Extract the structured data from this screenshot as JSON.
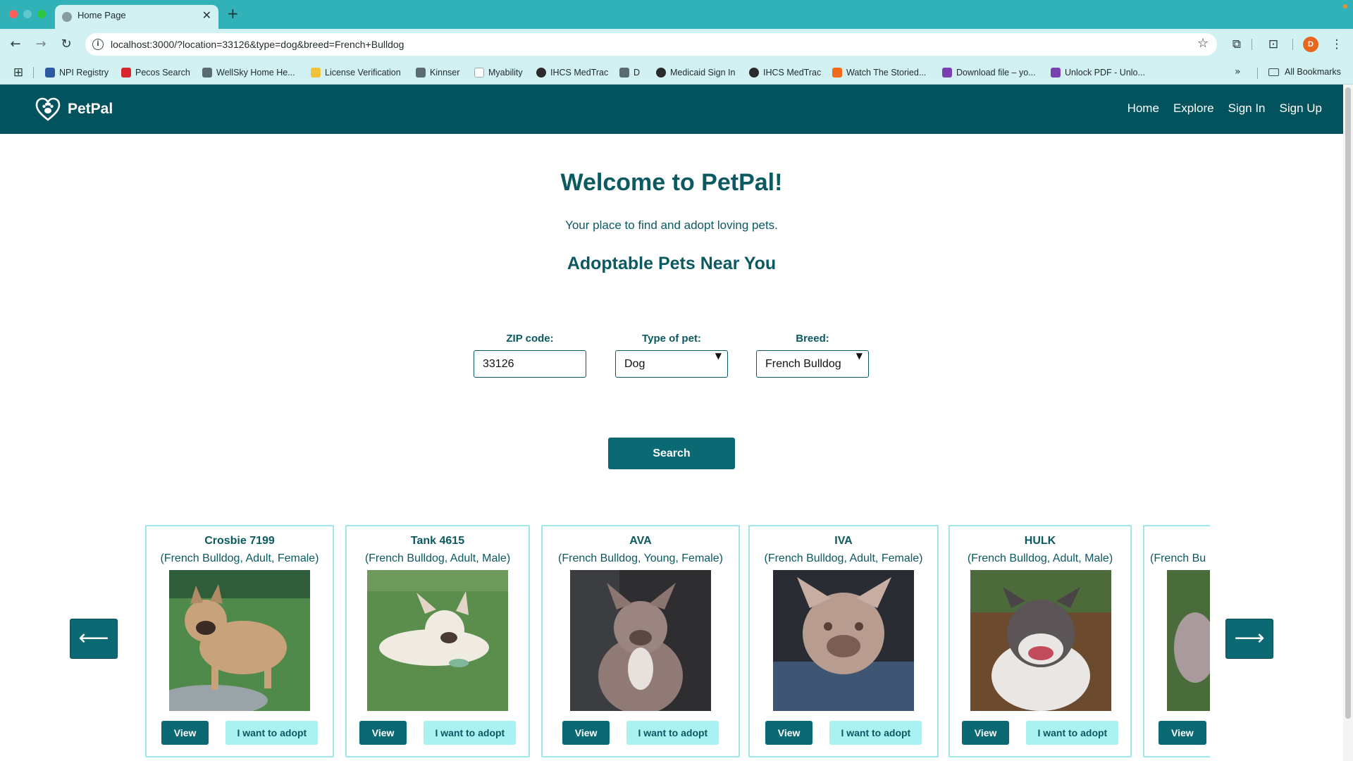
{
  "browser": {
    "tab_title": "Home Page",
    "tab_close": "✕",
    "new_tab": "+",
    "url": "localhost:3000/?location=33126&type=dog&breed=French+Bulldog",
    "profile_initial": "D",
    "bookmarks": [
      "NPI Registry",
      "Pecos Search",
      "WellSky Home He...",
      "License Verification",
      "Kinnser",
      "Myability",
      "IHCS MedTrac",
      "D",
      "Medicaid Sign In",
      "IHCS MedTrac",
      "Watch The Storied...",
      "Download file – yo...",
      "Unlock PDF - Unlo..."
    ],
    "overflow": "»",
    "all_bookmarks": "All Bookmarks",
    "accent_color": "#31b2b9"
  },
  "site": {
    "brand": "PetPal",
    "nav": [
      "Home",
      "Explore",
      "Sign In",
      "Sign Up"
    ],
    "primary_color": "#03535f"
  },
  "hero": {
    "title": "Welcome to PetPal!",
    "subtitle": "Your place to find and adopt loving pets.",
    "section_title": "Adoptable Pets Near You"
  },
  "search": {
    "zip_label": "ZIP code:",
    "zip_value": "33126",
    "type_label": "Type of pet:",
    "type_value": "Dog",
    "breed_label": "Breed:",
    "breed_value": "French Bulldog",
    "button_label": "Search"
  },
  "carousel": {
    "prev": "⟵",
    "next": "⟶",
    "pets": [
      {
        "name": "Crosbie 7199",
        "meta": "(French Bulldog, Adult, Female)",
        "view": "View",
        "adopt": "I want to adopt"
      },
      {
        "name": "Tank 4615",
        "meta": "(French Bulldog, Adult, Male)",
        "view": "View",
        "adopt": "I want to adopt"
      },
      {
        "name": "AVA",
        "meta": "(French Bulldog, Young, Female)",
        "view": "View",
        "adopt": "I want to adopt"
      },
      {
        "name": "IVA",
        "meta": "(French Bulldog, Adult, Female)",
        "view": "View",
        "adopt": "I want to adopt"
      },
      {
        "name": "HULK",
        "meta": "(French Bulldog, Adult, Male)",
        "view": "View",
        "adopt": "I want to adopt"
      },
      {
        "name": "",
        "meta": "(French Bu",
        "view": "View",
        "adopt": ""
      }
    ]
  }
}
